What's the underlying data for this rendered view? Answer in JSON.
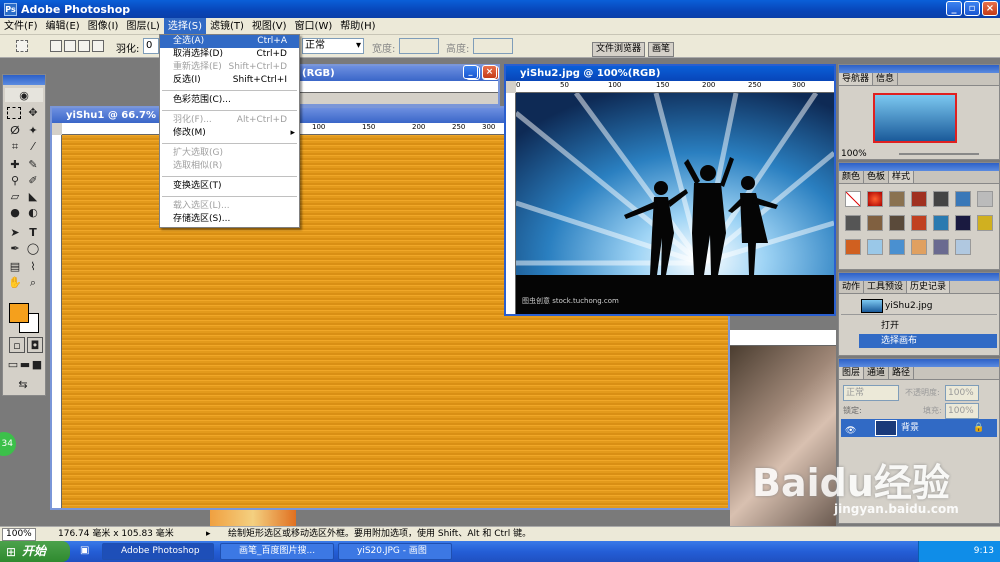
{
  "app": {
    "title": "Adobe Photoshop"
  },
  "menu": [
    "文件(F)",
    "编辑(E)",
    "图像(I)",
    "图层(L)",
    "选择(S)",
    "滤镜(T)",
    "视图(V)",
    "窗口(W)",
    "帮助(H)"
  ],
  "options": {
    "feather_label": "羽化:",
    "feather_value": "0",
    "style_value": "正常",
    "width_label": "宽度:",
    "height_label": "高度:",
    "file_browser_tab": "文件浏览器",
    "brush_tab": "画笔"
  },
  "select_menu": {
    "items": [
      {
        "label": "全选(A)",
        "shortcut": "Ctrl+A",
        "state": "highlight"
      },
      {
        "label": "取消选择(D)",
        "shortcut": "Ctrl+D",
        "state": "normal"
      },
      {
        "label": "重新选择(E)",
        "shortcut": "Shift+Ctrl+D",
        "state": "disabled"
      },
      {
        "label": "反选(I)",
        "shortcut": "Shift+Ctrl+I",
        "state": "normal"
      },
      {
        "label": "色彩范围(C)...",
        "shortcut": "",
        "state": "normal"
      },
      {
        "label": "羽化(F)...",
        "shortcut": "Alt+Ctrl+D",
        "state": "disabled"
      },
      {
        "label": "修改(M)",
        "shortcut": "▸",
        "state": "normal"
      },
      {
        "label": "扩大选取(G)",
        "shortcut": "",
        "state": "disabled"
      },
      {
        "label": "选取相似(R)",
        "shortcut": "",
        "state": "disabled"
      },
      {
        "label": "变换选区(T)",
        "shortcut": "",
        "state": "normal"
      },
      {
        "label": "载入选区(L)...",
        "shortcut": "",
        "state": "disabled"
      },
      {
        "label": "存储选区(S)...",
        "shortcut": "",
        "state": "normal"
      }
    ]
  },
  "docs": {
    "back_title": "(RGB)",
    "main_title": "yiShu1 @ 66.7%",
    "photo_title": "yiShu2.jpg @ 100%(RGB)",
    "photo_credit": "图虫创意 stock.tuchong.com",
    "ruler_main": [
      "100",
      "150",
      "200",
      "250",
      "300"
    ],
    "ruler_photo": [
      "0",
      "50",
      "100",
      "150",
      "200",
      "250",
      "300"
    ]
  },
  "navigator": {
    "tabs": [
      "导航器",
      "信息"
    ],
    "zoom": "100%"
  },
  "swatches": {
    "tabs": [
      "颜色",
      "色板",
      "样式"
    ]
  },
  "history": {
    "tabs": [
      "动作",
      "工具预设",
      "历史记录"
    ],
    "snapshot": "yiShu2.jpg",
    "items": [
      "打开",
      "选择画布"
    ]
  },
  "layers": {
    "tabs": [
      "图层",
      "通道",
      "路径"
    ],
    "blend": "正常",
    "opacity_label": "不透明度:",
    "opacity": "100%",
    "lock_label": "锁定:",
    "fill_label": "填充:",
    "fill": "100%",
    "layer_name": "背景"
  },
  "status": {
    "zoom": "100%",
    "dims": "176.74 毫米 x 105.83 毫米",
    "hint": "绘制矩形选区或移动选区外框。要用附加选项，使用 Shift、Alt 和 Ctrl 键。"
  },
  "taskbar": {
    "start": "开始",
    "tasks": [
      "Adobe Photoshop",
      "画笔_百度图片搜...",
      "yiS20.JPG - 画图"
    ],
    "time": "9:13"
  },
  "watermark": {
    "brand": "Baidu经验",
    "url": "jingyan.baidu.com"
  },
  "badge": "34",
  "colors": {
    "foreground": "#f5a01c",
    "background": "#ffffff",
    "accent": "#316ac5"
  }
}
